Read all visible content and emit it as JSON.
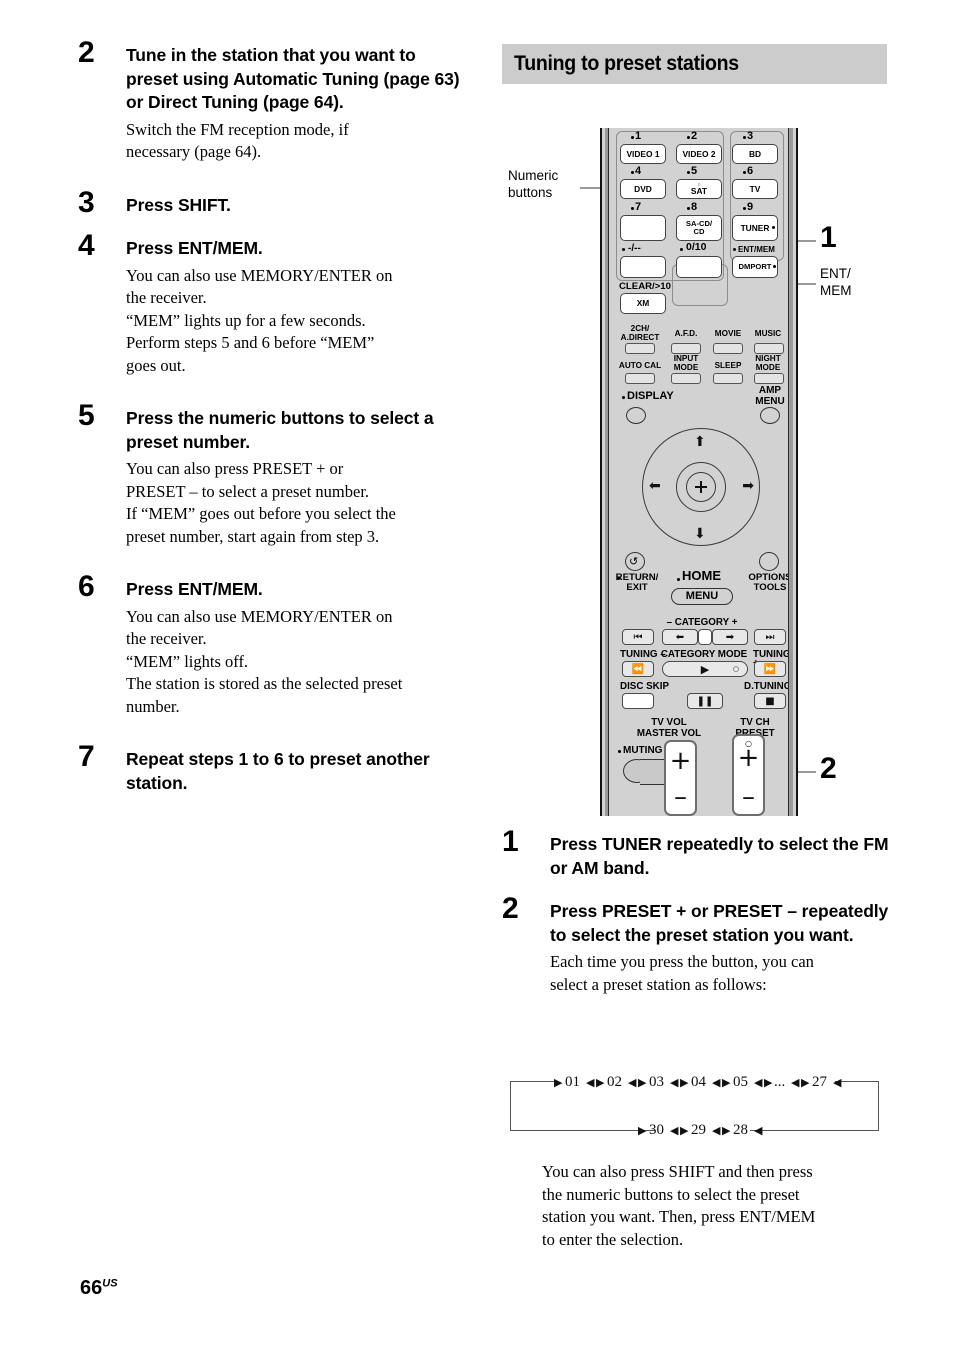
{
  "page": {
    "number": "66",
    "region": "US"
  },
  "left_column": {
    "steps": [
      {
        "num": "2",
        "title": "Tune in the station that you want to preset using Automatic Tuning (page 63) or Direct Tuning (page 64).",
        "body": [
          "Switch the FM reception mode, if",
          "necessary (page 64)."
        ]
      },
      {
        "num": "3",
        "title": "Press SHIFT.",
        "body": []
      },
      {
        "num": "4",
        "title": "Press ENT/MEM.",
        "body": [
          "You can also use MEMORY/ENTER on",
          "the receiver.",
          "“MEM” lights up for a few seconds.",
          "Perform steps 5 and 6 before “MEM”",
          "goes out."
        ]
      },
      {
        "num": "5",
        "title": "Press the numeric buttons to select a preset number.",
        "body": [
          "You can also press PRESET + or",
          "PRESET – to select a preset number.",
          "If “MEM” goes out before you select the",
          "preset number, start again from step 3."
        ]
      },
      {
        "num": "6",
        "title": "Press ENT/MEM.",
        "body": [
          "You can also use MEMORY/ENTER on",
          "the receiver.",
          "“MEM” lights off.",
          "The station is stored as the selected preset",
          "number."
        ]
      },
      {
        "num": "7",
        "title": "Repeat steps 1 to 6 to preset another station.",
        "body": []
      }
    ]
  },
  "right_column": {
    "section_heading": "Tuning to preset stations",
    "steps": [
      {
        "num": "1",
        "title": "Press TUNER repeatedly to select the FM or AM band.",
        "body": []
      },
      {
        "num": "2",
        "title": "Press PRESET + or PRESET – repeatedly to select the preset station you want.",
        "body": [
          "Each time you press the button, you can",
          "select a preset station as follows:"
        ]
      }
    ],
    "closing_note": [
      "You can also press SHIFT and then press",
      "the numeric buttons to select the preset",
      "station you want. Then, press ENT/MEM",
      "to enter the selection."
    ]
  },
  "figure": {
    "callouts": {
      "numeric_buttons": "Numeric\nbuttons",
      "marker_one": "1",
      "ent_mem": "ENT/\nMEM",
      "marker_two": "2"
    },
    "remote": {
      "numeric_keys": [
        {
          "digit": "1",
          "label": "VIDEO 1"
        },
        {
          "digit": "2",
          "label": "VIDEO 2"
        },
        {
          "digit": "3",
          "label": "BD"
        },
        {
          "digit": "4",
          "label": "DVD"
        },
        {
          "digit": "5",
          "label": "SAT"
        },
        {
          "digit": "6",
          "label": "TV"
        },
        {
          "digit": "7",
          "label": ""
        },
        {
          "digit": "8",
          "label": "SA-CD/\nCD"
        },
        {
          "digit": "9",
          "label": "TUNER"
        }
      ],
      "row4": {
        "minus_marker": "-/--",
        "zero_marker": "0/10",
        "ent_mem_marker": "ENT/MEM",
        "dmport": "DMPORT",
        "clear": "CLEAR/>10",
        "xm": "XM"
      },
      "sound_field_row1": [
        "2CH/\nA.DIRECT",
        "A.F.D.",
        "MOVIE",
        "MUSIC"
      ],
      "sound_field_row2": [
        "AUTO CAL",
        "INPUT\nMODE",
        "SLEEP",
        "NIGHT\nMODE"
      ],
      "display": "DISPLAY",
      "amp_menu": "AMP\nMENU",
      "return_exit": "RETURN/\nEXIT",
      "home": "HOME",
      "menu": "MENU",
      "options_tools": "OPTIONS\nTOOLS",
      "category": "– CATEGORY +",
      "tuning_minus": "TUNING –",
      "category_mode": "CATEGORY MODE",
      "tuning_plus": "TUNING +",
      "disc_skip": "DISC SKIP",
      "d_tuning": "D.TUNING",
      "tv_vol": "TV VOL",
      "master_vol": "MASTER VOL",
      "tv_ch": "TV CH",
      "preset": "PRESET",
      "muting": "MUTING"
    }
  },
  "cycle_diagram": {
    "top_row": [
      "01",
      "02",
      "03",
      "04",
      "05",
      "...",
      "27"
    ],
    "bottom_row": [
      "30",
      "29",
      "28"
    ]
  },
  "colors": {
    "heading_bg": "#cccccc",
    "remote_body": "#d2d2d2",
    "leader_line": "#9a9a9a"
  }
}
